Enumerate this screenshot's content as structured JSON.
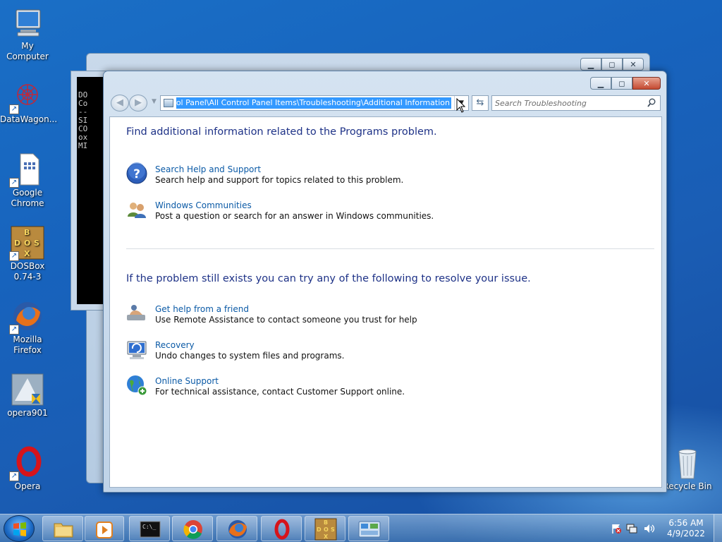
{
  "desktop": {
    "icons": [
      {
        "label": "My Computer",
        "icon": "computer-icon"
      },
      {
        "label": "DataWagon...",
        "icon": "datawagon-icon"
      },
      {
        "label": "Google Chrome",
        "icon": "chrome-shortcut-icon"
      },
      {
        "label": "DOSBox 0.74-3",
        "icon": "dosbox-icon"
      },
      {
        "label": "Mozilla Firefox",
        "icon": "firefox-icon"
      },
      {
        "label": "opera901",
        "icon": "opera901-icon"
      },
      {
        "label": "Opera",
        "icon": "opera-icon"
      },
      {
        "label": "Recycle Bin",
        "icon": "recycle-bin-icon"
      }
    ]
  },
  "console": {
    "lines": [
      "DO",
      "Co",
      "--",
      "SI",
      "",
      "CO",
      "ox",
      "MI"
    ]
  },
  "window": {
    "address_path": "Control Panel\\All Control Panel Items\\Troubleshooting\\Additional Information",
    "address_visible": "trol Panel\\All Control Panel Items\\Troubleshooting\\Additional Information",
    "search_placeholder": "Search Troubleshooting",
    "controls": {
      "minimize": "▭",
      "maximize": "◻",
      "close": "✕"
    }
  },
  "content": {
    "heading1": "Find additional information related to the Programs problem.",
    "section1": [
      {
        "link": "Search Help and Support",
        "desc": "Search help and support for topics related to this problem.",
        "icon": "help-icon"
      },
      {
        "link": "Windows Communities",
        "desc": "Post a question or search for an answer in Windows communities.",
        "icon": "community-icon"
      }
    ],
    "heading2": "If the problem still exists you can try any of the following to resolve your issue.",
    "section2": [
      {
        "link": "Get help from a friend",
        "desc": "Use Remote Assistance to contact someone you trust for help",
        "icon": "remote-assistance-icon"
      },
      {
        "link": "Recovery",
        "desc": "Undo changes to system files and programs.",
        "icon": "recovery-icon"
      },
      {
        "link": "Online Support",
        "desc": "For technical assistance, contact Customer Support online.",
        "icon": "globe-icon"
      }
    ]
  },
  "taskbar": {
    "buttons": [
      "explorer",
      "media-player",
      "command-prompt",
      "chrome",
      "firefox",
      "opera",
      "dosbox",
      "control-panel"
    ],
    "clock": {
      "time": "6:56 AM",
      "date": "4/9/2022"
    }
  },
  "colors": {
    "link": "#0b5aa6",
    "heading": "#1e3287",
    "selection": "#3399ff"
  }
}
